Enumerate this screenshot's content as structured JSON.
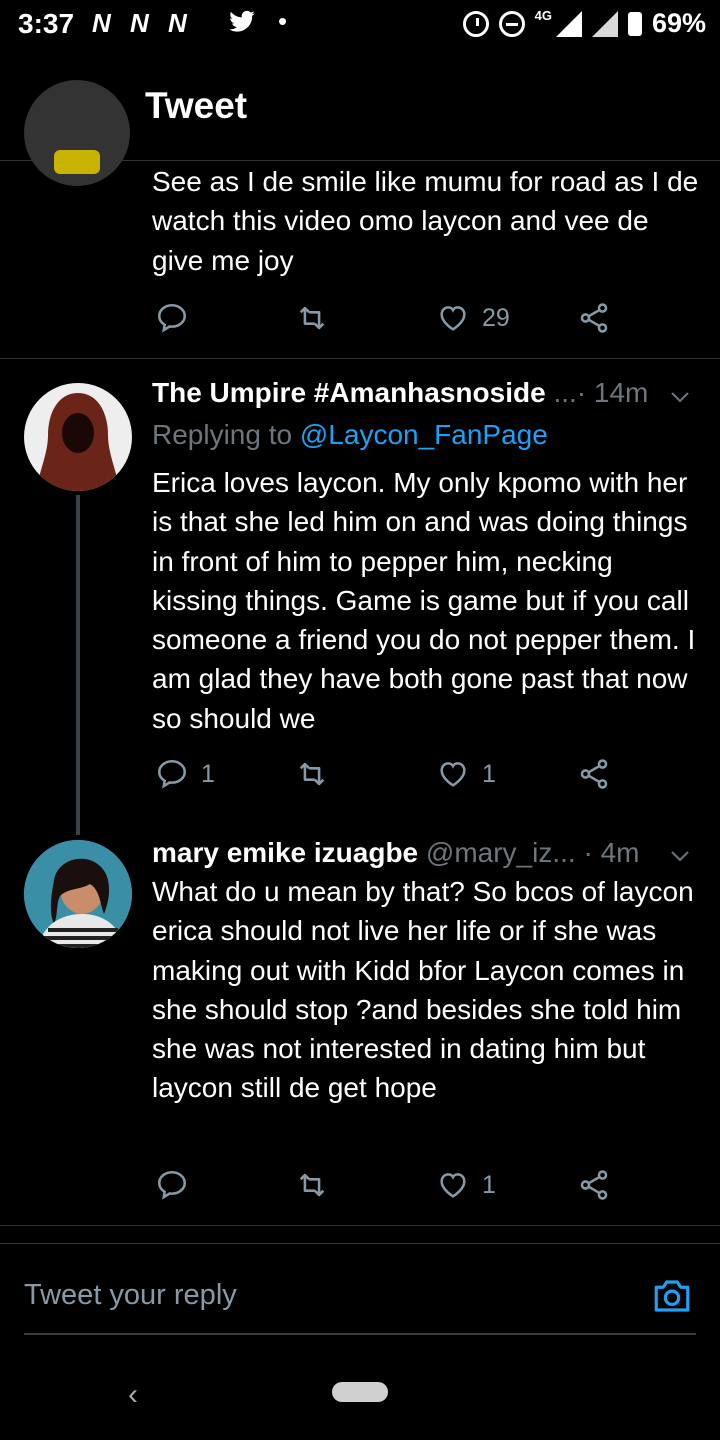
{
  "status_bar": {
    "time": "3:37",
    "carriers": "N N N",
    "network": "4G",
    "battery": "69%"
  },
  "header": {
    "title": "Tweet"
  },
  "tweets": [
    {
      "text": "See as I de smile like mumu for road as I de watch this video omo laycon and vee de give me joy",
      "reply_count": "",
      "retweet_count": "",
      "like_count": "29"
    },
    {
      "name": "The Umpire #Amanhasnoside",
      "handle_sep": "...· 14m",
      "replying_prefix": "Replying to",
      "replying_to": "@Laycon_FanPage",
      "text": "Erica loves laycon. My only kpomo with her is that she led him on and was doing things in front of him to pepper him, necking kissing things.  Game is game but if you call someone a friend you do not pepper them. I am glad they have both gone past that now so should we",
      "reply_count": "1",
      "retweet_count": "",
      "like_count": "1"
    },
    {
      "name": "mary emike izuagbe",
      "handle": "@mary_iz...",
      "time": "· 4m",
      "text": "What do u mean by that? So bcos of laycon erica should not live her life or if she was making out with Kidd bfor Laycon comes in she should stop ?and besides she told him she was not interested in dating him but laycon still de get hope",
      "reply_count": "",
      "retweet_count": "",
      "like_count": "1"
    }
  ],
  "reply_bar": {
    "placeholder": "Tweet your reply"
  },
  "colors": {
    "link": "#1da1f2",
    "muted": "#6e767d",
    "background": "#000000"
  }
}
